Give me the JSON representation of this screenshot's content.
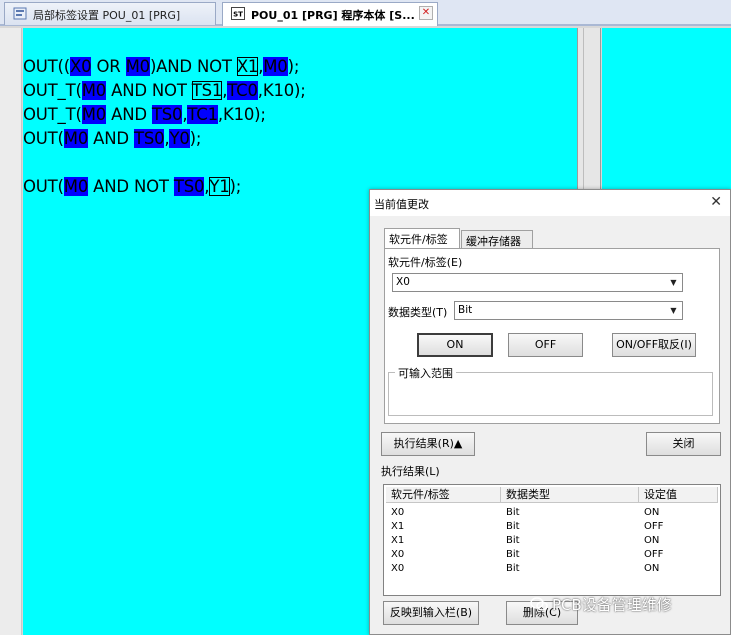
{
  "tabs": [
    {
      "label": "局部标签设置 POU_01 [PRG]",
      "active": false
    },
    {
      "label": "POU_01 [PRG] 程序本体 [S...",
      "active": true
    }
  ],
  "tab_close_glyph": "✕",
  "editor": {
    "background": "#00ffff",
    "highlight_color": "#0000ff",
    "lines": [
      [
        {
          "t": "OUT(("
        },
        {
          "t": "X0",
          "hl": true
        },
        {
          "t": " OR "
        },
        {
          "t": "M0",
          "hl": true
        },
        {
          "t": ")AND NOT "
        },
        {
          "t": "X1",
          "box": true
        },
        {
          "t": ","
        },
        {
          "t": "M0",
          "hl": true
        },
        {
          "t": ");"
        }
      ],
      [
        {
          "t": "OUT_T("
        },
        {
          "t": "M0",
          "hl": true
        },
        {
          "t": " AND NOT "
        },
        {
          "t": "TS1",
          "box": true
        },
        {
          "t": ","
        },
        {
          "t": "TC0",
          "hl": true
        },
        {
          "t": ",K10);"
        }
      ],
      [
        {
          "t": "OUT_T("
        },
        {
          "t": "M0",
          "hl": true
        },
        {
          "t": " AND "
        },
        {
          "t": "TS0",
          "hl": true
        },
        {
          "t": ","
        },
        {
          "t": "TC1",
          "hl": true
        },
        {
          "t": ",K10);"
        }
      ],
      [
        {
          "t": "OUT("
        },
        {
          "t": "M0",
          "hl": true
        },
        {
          "t": " AND "
        },
        {
          "t": "TS0",
          "hl": true
        },
        {
          "t": ","
        },
        {
          "t": "Y0",
          "hl": true
        },
        {
          "t": ");"
        }
      ],
      [],
      [
        {
          "t": "OUT("
        },
        {
          "t": "M0",
          "hl": true
        },
        {
          "t": " AND NOT "
        },
        {
          "t": "TS0",
          "hl": true
        },
        {
          "t": ","
        },
        {
          "t": "Y1",
          "box": true
        },
        {
          "t": ");"
        }
      ]
    ]
  },
  "dialog": {
    "title": "当前值更改",
    "close_glyph": "✕",
    "tabs": [
      "软元件/标签",
      "缓冲存储器"
    ],
    "device_label": "软元件/标签(E)",
    "device_value": "X0",
    "data_type_label": "数据类型(T)",
    "data_type_value": "Bit",
    "btn_on": "ON",
    "btn_off": "OFF",
    "btn_toggle": "ON/OFF取反(I)",
    "input_range_label": "可输入范围",
    "btn_exec_result": "执行结果(R)▲",
    "btn_close": "关闭",
    "results_label": "执行结果(L)",
    "results_columns": [
      "软元件/标签",
      "数据类型",
      "设定值"
    ],
    "results_rows": [
      [
        "X0",
        "Bit",
        "ON"
      ],
      [
        "X1",
        "Bit",
        "OFF"
      ],
      [
        "X1",
        "Bit",
        "ON"
      ],
      [
        "X0",
        "Bit",
        "OFF"
      ],
      [
        "X0",
        "Bit",
        "ON"
      ]
    ],
    "btn_reflect": "反映到输入栏(B)",
    "btn_delete": "删除(C)"
  },
  "watermark": "PCB设备管理维修"
}
